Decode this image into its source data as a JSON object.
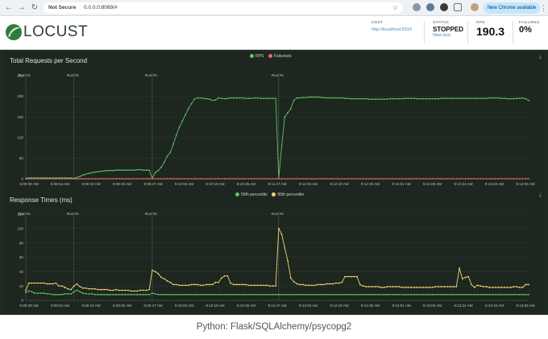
{
  "browser": {
    "security_label": "Not Secure",
    "url": "0.0.0.0:8089/#",
    "update_button": "New Chrome available",
    "colors": {
      "toolbar": "#eef1f5",
      "update_pill": "#c2e7ff"
    }
  },
  "app": {
    "logo_text": "LOCUST",
    "stats": {
      "host_label": "HOST",
      "host_value": "http://localhost:5010",
      "status_label": "STATUS",
      "status_value": "STOPPED",
      "new_test_link": "New test",
      "rps_label": "RPS",
      "rps_value": "190.3",
      "failures_label": "FAILURES",
      "failures_value": "0%"
    },
    "colors": {
      "background": "#1f2a22",
      "rps_series": "#5fc46a",
      "failures_series": "#e36a6a",
      "p50_series": "#5fc46a",
      "p95_series": "#f0d36e"
    }
  },
  "caption": "Python: Flask/SQLAlchemy/psycopg2",
  "chart_data": [
    {
      "type": "line",
      "title": "Total Requests per Second",
      "legend_position": "top-center",
      "ylim": [
        0,
        250
      ],
      "y_ticks": [
        0,
        50,
        100,
        150,
        200,
        250
      ],
      "x_ticks": [
        "9:08:38 AM",
        "9:08:54 AM",
        "9:09:10 AM",
        "9:09:26 AM",
        "9:09:47 AM",
        "9:10:03 AM",
        "9:10:19 AM",
        "9:10:35 AM",
        "9:11:47 AM",
        "9:12:03 AM",
        "9:12:19 AM",
        "9:12:35 AM",
        "9:12:51 AM",
        "9:13:08 AM",
        "9:13:24 AM",
        "9:13:40 AM",
        "9:13:56 AM"
      ],
      "run_markers": [
        {
          "label": "Run #1",
          "index": 0
        },
        {
          "label": "Run #2",
          "index": 16
        },
        {
          "label": "Run #3",
          "index": 42
        },
        {
          "label": "Run #4",
          "index": 84
        }
      ],
      "series": [
        {
          "name": "RPS",
          "values": [
            1,
            2,
            2,
            2,
            2,
            2,
            2,
            2,
            2,
            2,
            2,
            2,
            2,
            2,
            2,
            2,
            1,
            3,
            6,
            9,
            11,
            13,
            15,
            16,
            17,
            18,
            19,
            20,
            20,
            20,
            21,
            21,
            21,
            21,
            21,
            21,
            21,
            22,
            22,
            21,
            21,
            21,
            1,
            15,
            20,
            28,
            40,
            55,
            64,
            84,
            106,
            125,
            140,
            155,
            170,
            182,
            193,
            196,
            196,
            195,
            194,
            193,
            190,
            191,
            196,
            195,
            194,
            195,
            196,
            196,
            196,
            196,
            196,
            195,
            195,
            195,
            196,
            196,
            195,
            195,
            195,
            195,
            195,
            195,
            1,
            80,
            150,
            160,
            170,
            190,
            196,
            196,
            197,
            197,
            198,
            198,
            198,
            198,
            197,
            197,
            196,
            196,
            196,
            196,
            196,
            196,
            195,
            195,
            194,
            194,
            194,
            194,
            194,
            194,
            193,
            193,
            193,
            193,
            193,
            193,
            193,
            194,
            194,
            194,
            194,
            194,
            195,
            195,
            195,
            195,
            194,
            194,
            194,
            194,
            194,
            194,
            194,
            194,
            195,
            195,
            195,
            195,
            195,
            195,
            195,
            195,
            195,
            195,
            195,
            195,
            195,
            195,
            195,
            195,
            196,
            196,
            196,
            196,
            195,
            195,
            194,
            194,
            194,
            195,
            195,
            196,
            194,
            190
          ]
        },
        {
          "name": "Failures/s",
          "values": [
            0,
            0,
            0,
            0,
            0,
            0,
            0,
            0,
            0,
            0,
            0,
            0,
            0,
            0,
            0,
            0,
            0,
            0,
            0,
            0,
            0,
            0,
            0,
            0,
            0,
            0,
            0,
            0,
            0,
            0,
            0,
            0,
            0,
            0,
            0,
            0,
            0,
            0,
            0,
            0,
            0,
            0,
            0,
            0,
            0,
            0,
            0,
            0,
            0,
            0,
            0,
            0,
            0,
            0,
            0,
            0,
            0,
            0,
            0,
            0,
            0,
            0,
            0,
            0,
            0,
            0,
            0,
            0,
            0,
            0,
            0,
            0,
            0,
            0,
            0,
            0,
            0,
            0,
            0,
            0,
            0,
            0,
            0,
            0,
            0,
            0,
            0,
            0,
            0,
            0,
            0,
            0,
            0,
            0,
            0,
            0,
            0,
            0,
            0,
            0,
            0,
            0,
            0,
            0,
            0,
            0,
            0,
            0,
            0,
            0,
            0,
            0,
            0,
            0,
            0,
            0,
            0,
            0,
            0,
            0,
            0,
            0,
            0,
            0,
            0,
            0,
            0,
            0,
            0,
            0,
            0,
            0,
            0,
            0,
            0,
            0,
            0,
            0,
            0,
            0,
            0,
            0,
            0,
            0,
            0,
            0,
            0,
            0,
            0,
            0,
            0,
            0,
            0,
            0,
            0,
            0,
            0,
            0,
            0,
            0,
            0,
            0,
            0,
            0,
            0,
            0,
            0,
            0
          ]
        }
      ]
    },
    {
      "type": "line",
      "title": "Response Times (ms)",
      "legend_position": "top-center",
      "ylim": [
        0,
        120
      ],
      "y_ticks": [
        0,
        20,
        40,
        60,
        80,
        100,
        120
      ],
      "x_ticks": [
        "9:08:38 AM",
        "9:08:54 AM",
        "9:09:10 AM",
        "9:09:26 AM",
        "9:09:47 AM",
        "9:10:03 AM",
        "9:10:19 AM",
        "9:10:35 AM",
        "9:11:47 AM",
        "9:12:03 AM",
        "9:12:19 AM",
        "9:12:35 AM",
        "9:12:51 AM",
        "9:13:08 AM",
        "9:13:24 AM",
        "9:13:40 AM",
        "9:13:56 AM"
      ],
      "run_markers": [
        {
          "label": "Run #1",
          "index": 0
        },
        {
          "label": "Run #2",
          "index": 16
        },
        {
          "label": "Run #3",
          "index": 42
        },
        {
          "label": "Run #4",
          "index": 84
        }
      ],
      "series": [
        {
          "name": "50th percentile",
          "values": [
            11,
            13,
            12,
            10,
            10,
            10,
            10,
            9,
            9,
            8,
            8,
            8,
            8,
            9,
            9,
            9,
            12,
            14,
            12,
            10,
            9,
            9,
            9,
            8,
            8,
            8,
            8,
            8,
            8,
            8,
            8,
            8,
            8,
            8,
            8,
            8,
            8,
            8,
            8,
            8,
            8,
            8,
            10,
            9,
            8,
            8,
            8,
            8,
            8,
            8,
            8,
            8,
            8,
            8,
            8,
            8,
            8,
            8,
            8,
            8,
            8,
            8,
            8,
            8,
            8,
            8,
            8,
            8,
            8,
            8,
            8,
            8,
            8,
            8,
            8,
            8,
            8,
            8,
            8,
            8,
            8,
            8,
            8,
            8,
            8,
            8,
            8,
            8,
            8,
            8,
            8,
            8,
            8,
            8,
            8,
            8,
            8,
            8,
            8,
            8,
            8,
            8,
            8,
            8,
            8,
            8,
            8,
            8,
            8,
            8,
            8,
            8,
            8,
            8,
            8,
            8,
            8,
            8,
            8,
            8,
            8,
            8,
            8,
            8,
            8,
            8,
            8,
            8,
            8,
            8,
            8,
            8,
            8,
            8,
            8,
            8,
            8,
            8,
            8,
            8,
            8,
            8,
            8,
            8,
            8,
            8,
            8,
            8,
            8,
            8,
            8,
            8,
            8,
            8,
            8,
            8,
            8,
            8,
            8,
            8,
            8,
            8,
            8,
            8,
            8,
            8,
            8,
            8
          ]
        },
        {
          "name": "95th percentile",
          "values": [
            14,
            24,
            24,
            24,
            24,
            24,
            24,
            23,
            23,
            23,
            24,
            20,
            20,
            18,
            16,
            15,
            20,
            23,
            19,
            17,
            17,
            16,
            16,
            16,
            15,
            15,
            15,
            15,
            14,
            14,
            15,
            14,
            14,
            14,
            14,
            13,
            13,
            13,
            14,
            14,
            14,
            15,
            42,
            40,
            37,
            32,
            30,
            27,
            25,
            22,
            22,
            21,
            21,
            21,
            21,
            22,
            22,
            22,
            21,
            21,
            22,
            22,
            22,
            25,
            25,
            31,
            34,
            34,
            24,
            22,
            22,
            22,
            22,
            22,
            21,
            21,
            21,
            21,
            21,
            21,
            21,
            20,
            20,
            20,
            100,
            92,
            73,
            55,
            31,
            26,
            23,
            22,
            22,
            21,
            21,
            21,
            21,
            22,
            22,
            22,
            23,
            23,
            23,
            24,
            24,
            25,
            33,
            33,
            33,
            33,
            33,
            22,
            20,
            19,
            19,
            19,
            19,
            19,
            18,
            18,
            19,
            19,
            19,
            19,
            19,
            18,
            18,
            18,
            18,
            18,
            18,
            18,
            18,
            18,
            18,
            18,
            19,
            19,
            19,
            19,
            19,
            19,
            19,
            19,
            45,
            30,
            32,
            33,
            22,
            18,
            21,
            20,
            19,
            19,
            18,
            18,
            18,
            18,
            18,
            18,
            18,
            18,
            19,
            19,
            18,
            18,
            22,
            22
          ]
        }
      ]
    }
  ]
}
